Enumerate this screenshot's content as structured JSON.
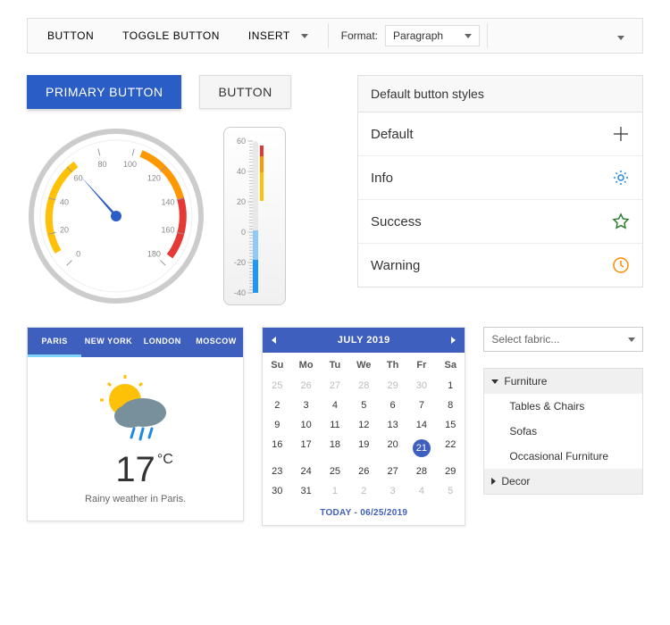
{
  "toolbar": {
    "button": "BUTTON",
    "toggle": "TOGGLE BUTTON",
    "insert": "INSERT",
    "format_label": "Format:",
    "format_value": "Paragraph"
  },
  "buttons": {
    "primary": "PRIMARY BUTTON",
    "secondary": "BUTTON"
  },
  "chart_data": [
    {
      "type": "gauge",
      "value": 60,
      "min": 0,
      "max": 180,
      "ticks": [
        0,
        20,
        40,
        60,
        80,
        100,
        120,
        140,
        160,
        180
      ],
      "ranges": [
        {
          "from": 40,
          "to": 90,
          "color": "#FFC107"
        },
        {
          "from": 90,
          "to": 130,
          "color": "#FF9800"
        },
        {
          "from": 130,
          "to": 180,
          "color": "#E53935"
        }
      ]
    },
    {
      "type": "thermometer",
      "value": 10,
      "min": -40,
      "max": 60,
      "ticks": [
        -40,
        -20,
        0,
        20,
        40,
        60
      ],
      "ranges": [
        {
          "from": -40,
          "to": 0,
          "color": "#2196F3"
        },
        {
          "from": 0,
          "to": 20,
          "color": "#90CAF9"
        },
        {
          "from": 20,
          "to": 40,
          "color": "#FFC107"
        },
        {
          "from": 40,
          "to": 50,
          "color": "#FF9800"
        },
        {
          "from": 50,
          "to": 60,
          "color": "#E53935"
        }
      ]
    }
  ],
  "styles_panel": {
    "header": "Default button styles",
    "items": [
      "Default",
      "Info",
      "Success",
      "Warning"
    ]
  },
  "weather": {
    "tabs": [
      "PARIS",
      "NEW YORK",
      "LONDON",
      "MOSCOW"
    ],
    "active_tab": 0,
    "temp": "17",
    "unit": "°C",
    "desc": "Rainy weather in Paris."
  },
  "calendar": {
    "title": "JULY 2019",
    "dow": [
      "Su",
      "Mo",
      "Tu",
      "We",
      "Th",
      "Fr",
      "Sa"
    ],
    "weeks": [
      [
        {
          "d": 25,
          "m": true
        },
        {
          "d": 26,
          "m": true
        },
        {
          "d": 27,
          "m": true
        },
        {
          "d": 28,
          "m": true
        },
        {
          "d": 29,
          "m": true
        },
        {
          "d": 30,
          "m": true
        },
        {
          "d": 1
        }
      ],
      [
        {
          "d": 2
        },
        {
          "d": 3
        },
        {
          "d": 4
        },
        {
          "d": 5
        },
        {
          "d": 6
        },
        {
          "d": 7
        },
        {
          "d": 8
        }
      ],
      [
        {
          "d": 9
        },
        {
          "d": 10
        },
        {
          "d": 11
        },
        {
          "d": 12
        },
        {
          "d": 13
        },
        {
          "d": 14
        },
        {
          "d": 15
        }
      ],
      [
        {
          "d": 16
        },
        {
          "d": 17
        },
        {
          "d": 18
        },
        {
          "d": 19
        },
        {
          "d": 20
        },
        {
          "d": 21,
          "sel": true
        },
        {
          "d": 22
        }
      ],
      [
        {
          "d": 23
        },
        {
          "d": 24
        },
        {
          "d": 25
        },
        {
          "d": 26
        },
        {
          "d": 27
        },
        {
          "d": 28
        },
        {
          "d": 29
        }
      ],
      [
        {
          "d": 30
        },
        {
          "d": 31
        },
        {
          "d": 1,
          "m": true
        },
        {
          "d": 2,
          "m": true
        },
        {
          "d": 3,
          "m": true
        },
        {
          "d": 4,
          "m": true
        },
        {
          "d": 5,
          "m": true
        }
      ]
    ],
    "footer": "TODAY - 06/25/2019"
  },
  "combo": {
    "placeholder": "Select fabric..."
  },
  "tree": {
    "items": [
      {
        "label": "Furniture",
        "type": "parent",
        "expanded": true
      },
      {
        "label": "Tables & Chairs",
        "type": "child"
      },
      {
        "label": "Sofas",
        "type": "child"
      },
      {
        "label": "Occasional Furniture",
        "type": "child"
      },
      {
        "label": "Decor",
        "type": "parent",
        "expanded": false
      }
    ]
  }
}
